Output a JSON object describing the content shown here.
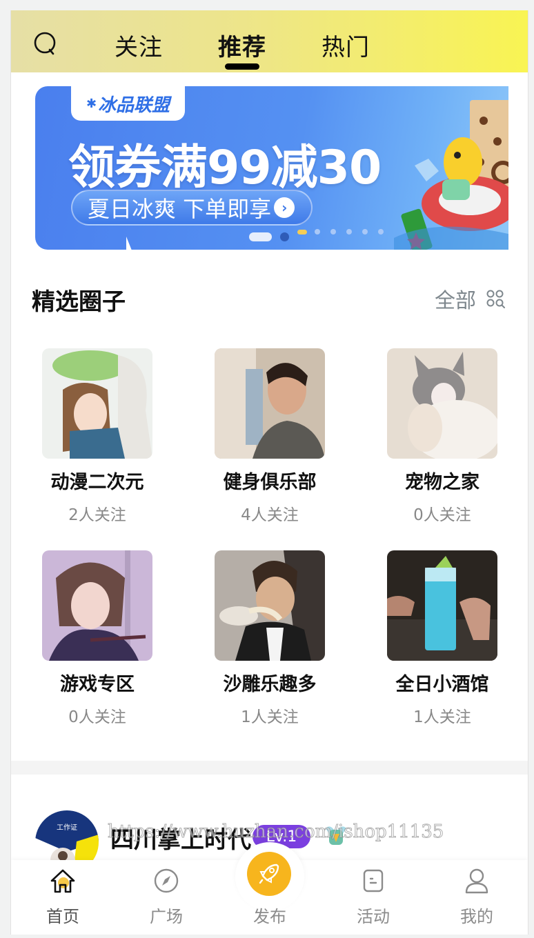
{
  "header": {
    "search_icon": "search-icon",
    "tabs": [
      {
        "label": "关注",
        "active": false
      },
      {
        "label": "推荐",
        "active": true
      },
      {
        "label": "热门",
        "active": false
      }
    ]
  },
  "banner": {
    "brand": "冰品联盟",
    "headline": "领券满99减30",
    "cta": "夏日冰爽 下单即享",
    "cta_icon": "chevron-right-icon",
    "slide_count": 9,
    "active_slide": 1
  },
  "section": {
    "title": "精选圈子",
    "all_label": "全部",
    "all_icon": "grid-search-icon"
  },
  "circles": [
    {
      "name": "动漫二次元",
      "followers": "2人关注",
      "image": "anime-illustration"
    },
    {
      "name": "健身俱乐部",
      "followers": "4人关注",
      "image": "man-portrait"
    },
    {
      "name": "宠物之家",
      "followers": "0人关注",
      "image": "kitten-photo"
    },
    {
      "name": "游戏专区",
      "followers": "0人关注",
      "image": "game-character"
    },
    {
      "name": "沙雕乐趣多",
      "followers": "1人关注",
      "image": "man-eating-noodles"
    },
    {
      "name": "全日小酒馆",
      "followers": "1人关注",
      "image": "blue-cocktail"
    }
  ],
  "post": {
    "author": "四川掌上时代",
    "level": "Lv.1",
    "avatar_text": "工作证",
    "watermark": "https://www.huzhan.com/ishop11135"
  },
  "tabbar": {
    "items": [
      {
        "label": "首页",
        "icon": "home-icon",
        "active": true
      },
      {
        "label": "广场",
        "icon": "compass-icon",
        "active": false
      },
      {
        "label": "发布",
        "icon": "rocket-icon",
        "active": false
      },
      {
        "label": "活动",
        "icon": "activity-icon",
        "active": false
      },
      {
        "label": "我的",
        "icon": "user-icon",
        "active": false
      }
    ]
  },
  "colors": {
    "header_gradient_start": "#e6dfa6",
    "header_gradient_end": "#f9f453",
    "banner_blue": "#4a7fee",
    "publish_orange": "#f7b51d",
    "level_purple": "#7b3fe0",
    "muted_text": "#888888"
  }
}
